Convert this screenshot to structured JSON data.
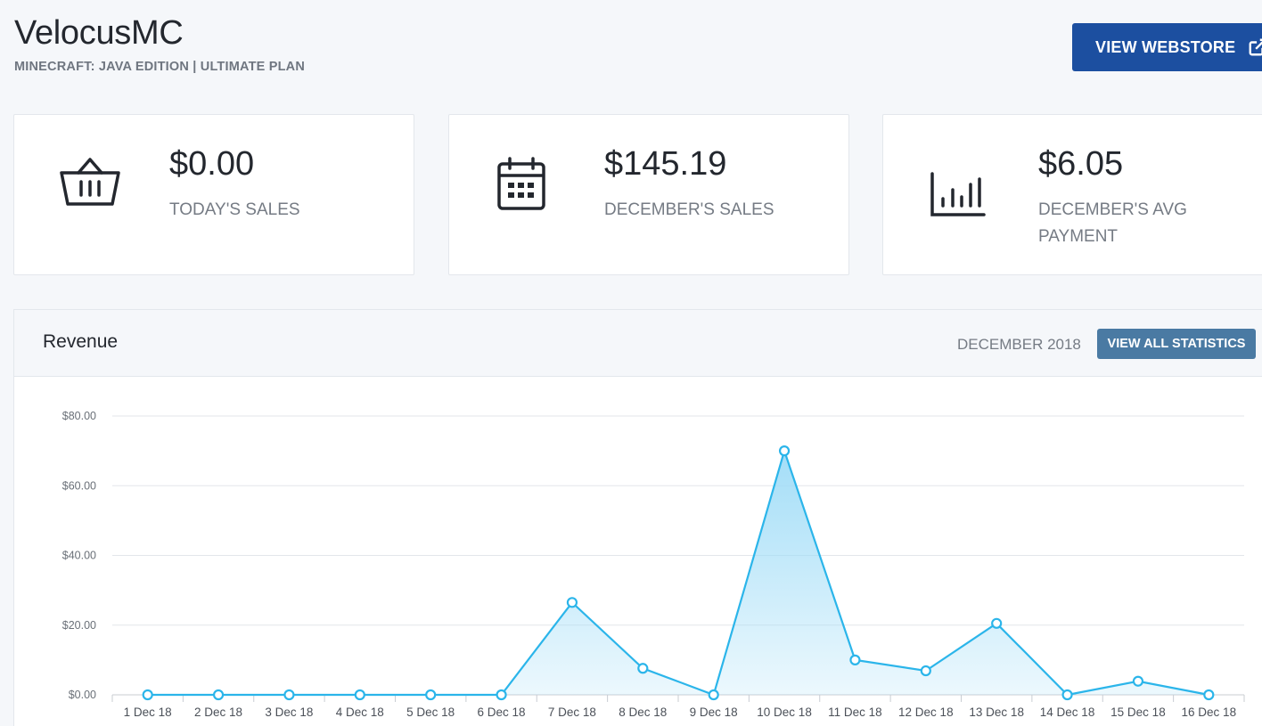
{
  "header": {
    "title": "VelocusMC",
    "subtitle": "MINECRAFT: JAVA EDITION | ULTIMATE PLAN",
    "webstore_label": "VIEW WEBSTORE"
  },
  "stats": [
    {
      "value": "$0.00",
      "label": "TODAY'S SALES",
      "icon": "basket-icon"
    },
    {
      "value": "$145.19",
      "label": "DECEMBER'S SALES",
      "icon": "calendar-icon"
    },
    {
      "value": "$6.05",
      "label": "DECEMBER'S AVG PAYMENT",
      "icon": "bar-chart-icon"
    }
  ],
  "revenue": {
    "title": "Revenue",
    "period": "DECEMBER 2018",
    "button_label": "VIEW ALL STATISTICS"
  },
  "colors": {
    "accent": "#1c4fa0",
    "secondary_button": "#4a7aa3",
    "series_line": "#2bb5ea",
    "series_fill": "#9fdcf7"
  },
  "chart_data": {
    "type": "area",
    "x": [
      "1 Dec 18",
      "2 Dec 18",
      "3 Dec 18",
      "4 Dec 18",
      "5 Dec 18",
      "6 Dec 18",
      "7 Dec 18",
      "8 Dec 18",
      "9 Dec 18",
      "10 Dec 18",
      "11 Dec 18",
      "12 Dec 18",
      "13 Dec 18",
      "14 Dec 18",
      "15 Dec 18",
      "16 Dec 18"
    ],
    "series": [
      {
        "values": [
          0,
          0,
          0,
          0,
          0,
          0,
          26.5,
          7.6,
          0,
          70,
          10,
          6.9,
          20.5,
          0,
          3.9,
          0
        ]
      }
    ],
    "yticks": [
      "$0.00",
      "$20.00",
      "$40.00",
      "$60.00",
      "$80.00"
    ],
    "ylim": [
      0,
      80
    ],
    "grid": true
  }
}
